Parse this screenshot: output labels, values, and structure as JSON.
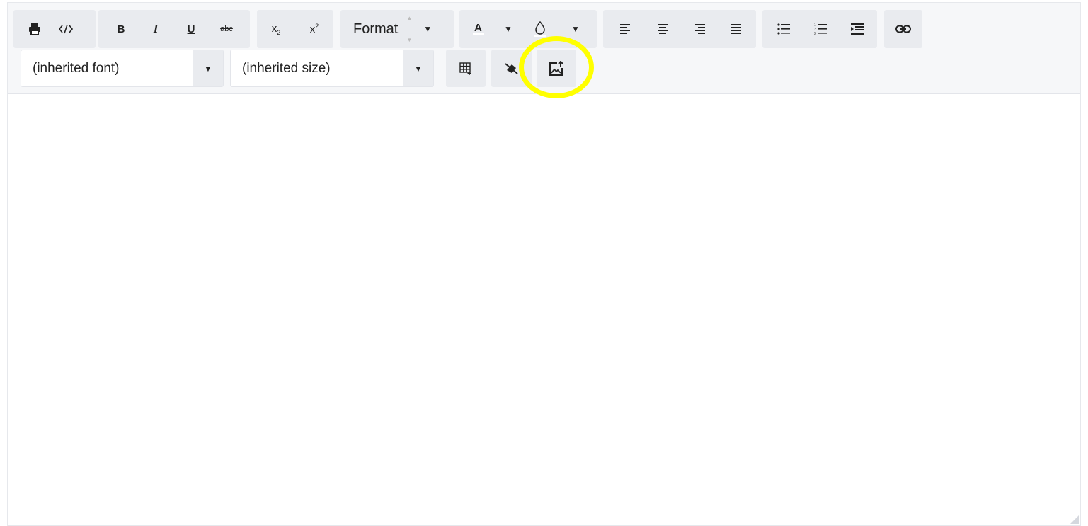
{
  "toolbar": {
    "row1": {
      "print_icon": "print-icon",
      "source_icon": "source-code-icon",
      "bold": "B",
      "italic": "I",
      "underline": "U",
      "strike": "abc",
      "subscript": "x",
      "subscript_small": "2",
      "superscript": "x",
      "superscript_small": "2",
      "format_label": "Format",
      "font_color_icon": "font-color-icon",
      "background_color_icon": "background-color-icon",
      "align_left_icon": "align-left-icon",
      "align_center_icon": "align-center-icon",
      "align_right_icon": "align-right-icon",
      "align_justify_icon": "align-justify-icon",
      "bullet_list_icon": "bullet-list-icon",
      "numbered_list_icon": "numbered-list-icon",
      "indent_icon": "indent-icon",
      "link_icon": "link-icon"
    },
    "row2": {
      "font_select": "(inherited font)",
      "size_select": "(inherited size)",
      "table_icon": "insert-table-icon",
      "clear_format_icon": "clear-formatting-icon",
      "upload_image_icon": "upload-image-icon"
    }
  },
  "colors": {
    "toolbar_bg": "#f6f7f9",
    "button_group_bg": "#e9ebef",
    "highlight": "#ffff00"
  }
}
